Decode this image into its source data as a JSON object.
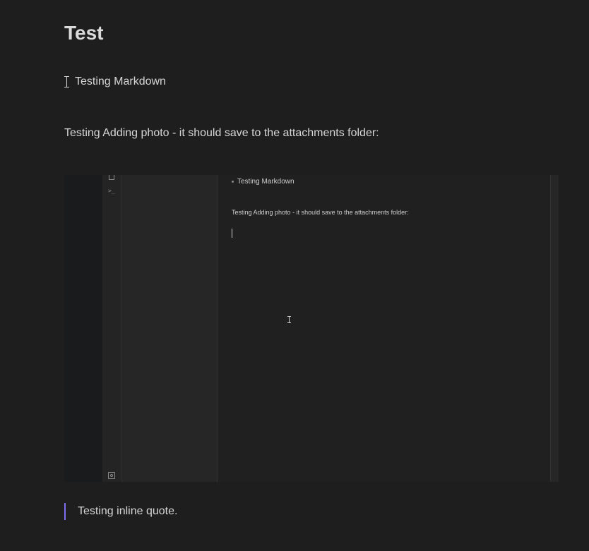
{
  "note": {
    "title": "Test",
    "bullet_text": "Testing Markdown",
    "paragraph": "Testing Adding photo - it should save to the attachments folder:",
    "quote": "Testing inline quote."
  },
  "embedded_image": {
    "bullet_text": "Testing Markdown",
    "paragraph": "Testing Adding photo - it should save to the attachments folder:",
    "ribbon_icons": [
      "copy-icon",
      "terminal-icon",
      "settings-icon"
    ]
  },
  "colors": {
    "background": "#1e1e1e",
    "text": "#dcddde",
    "quote_accent": "#7f6df2"
  }
}
